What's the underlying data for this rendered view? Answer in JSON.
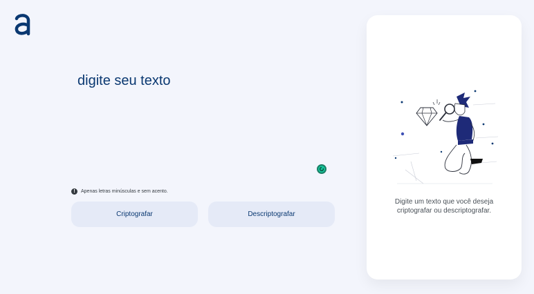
{
  "brand": {
    "logo_icon": "alura-logo-icon",
    "color": "#0a3871"
  },
  "input": {
    "placeholder": "digite seu texto",
    "value": ""
  },
  "notice": {
    "icon": "info-icon",
    "text": "Apenas letras minúsculas e sem acento."
  },
  "buttons": {
    "encrypt_label": "Criptografar",
    "decrypt_label": "Descriptografar"
  },
  "output": {
    "illustration": "person-with-magnifier-and-diamond-illustration",
    "message_line1": "Digite um texto que você deseja",
    "message_line2": "criptografar ou descriptografar."
  },
  "colors": {
    "background": "#f3f5fc",
    "primary": "#0a3871",
    "button_bg": "#e5eaf7",
    "card_bg": "#ffffff",
    "grammarly": "#15c39a"
  }
}
